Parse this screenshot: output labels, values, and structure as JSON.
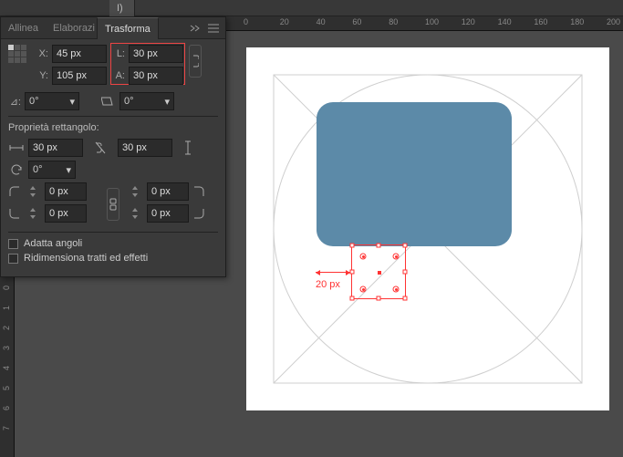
{
  "title_suffix": "I)",
  "tabs": {
    "align": "Allinea",
    "process": "Elaborazi",
    "transform": "Trasforma"
  },
  "xy": {
    "x_label": "X:",
    "x": "45 px",
    "y_label": "Y:",
    "y": "105 px",
    "w_label": "L:",
    "w": "30 px",
    "h_label": "A:",
    "h": "30 px"
  },
  "angle": {
    "rot_label": "⊿:",
    "rot": "0°",
    "shear_label": "",
    "shear": "0°"
  },
  "rect_section": "Proprietà rettangolo:",
  "rect": {
    "width": "30 px",
    "height": "30 px",
    "corner_angle": "0°",
    "tl": "0 px",
    "tr": "0 px",
    "bl": "0 px",
    "br": "0 px"
  },
  "options": {
    "scale_corners": "Adatta angoli",
    "scale_strokes": "Ridimensiona tratti ed effetti"
  },
  "ruler_h": [
    "0",
    "20",
    "40",
    "60",
    "80",
    "100",
    "120",
    "140",
    "160",
    "180",
    "200"
  ],
  "ruler_v": [
    "0",
    "1",
    "2",
    "3",
    "4",
    "5",
    "6",
    "7"
  ],
  "annotation": "20 px",
  "colors": {
    "shape": "#5c8aa8",
    "sel": "#f33"
  }
}
